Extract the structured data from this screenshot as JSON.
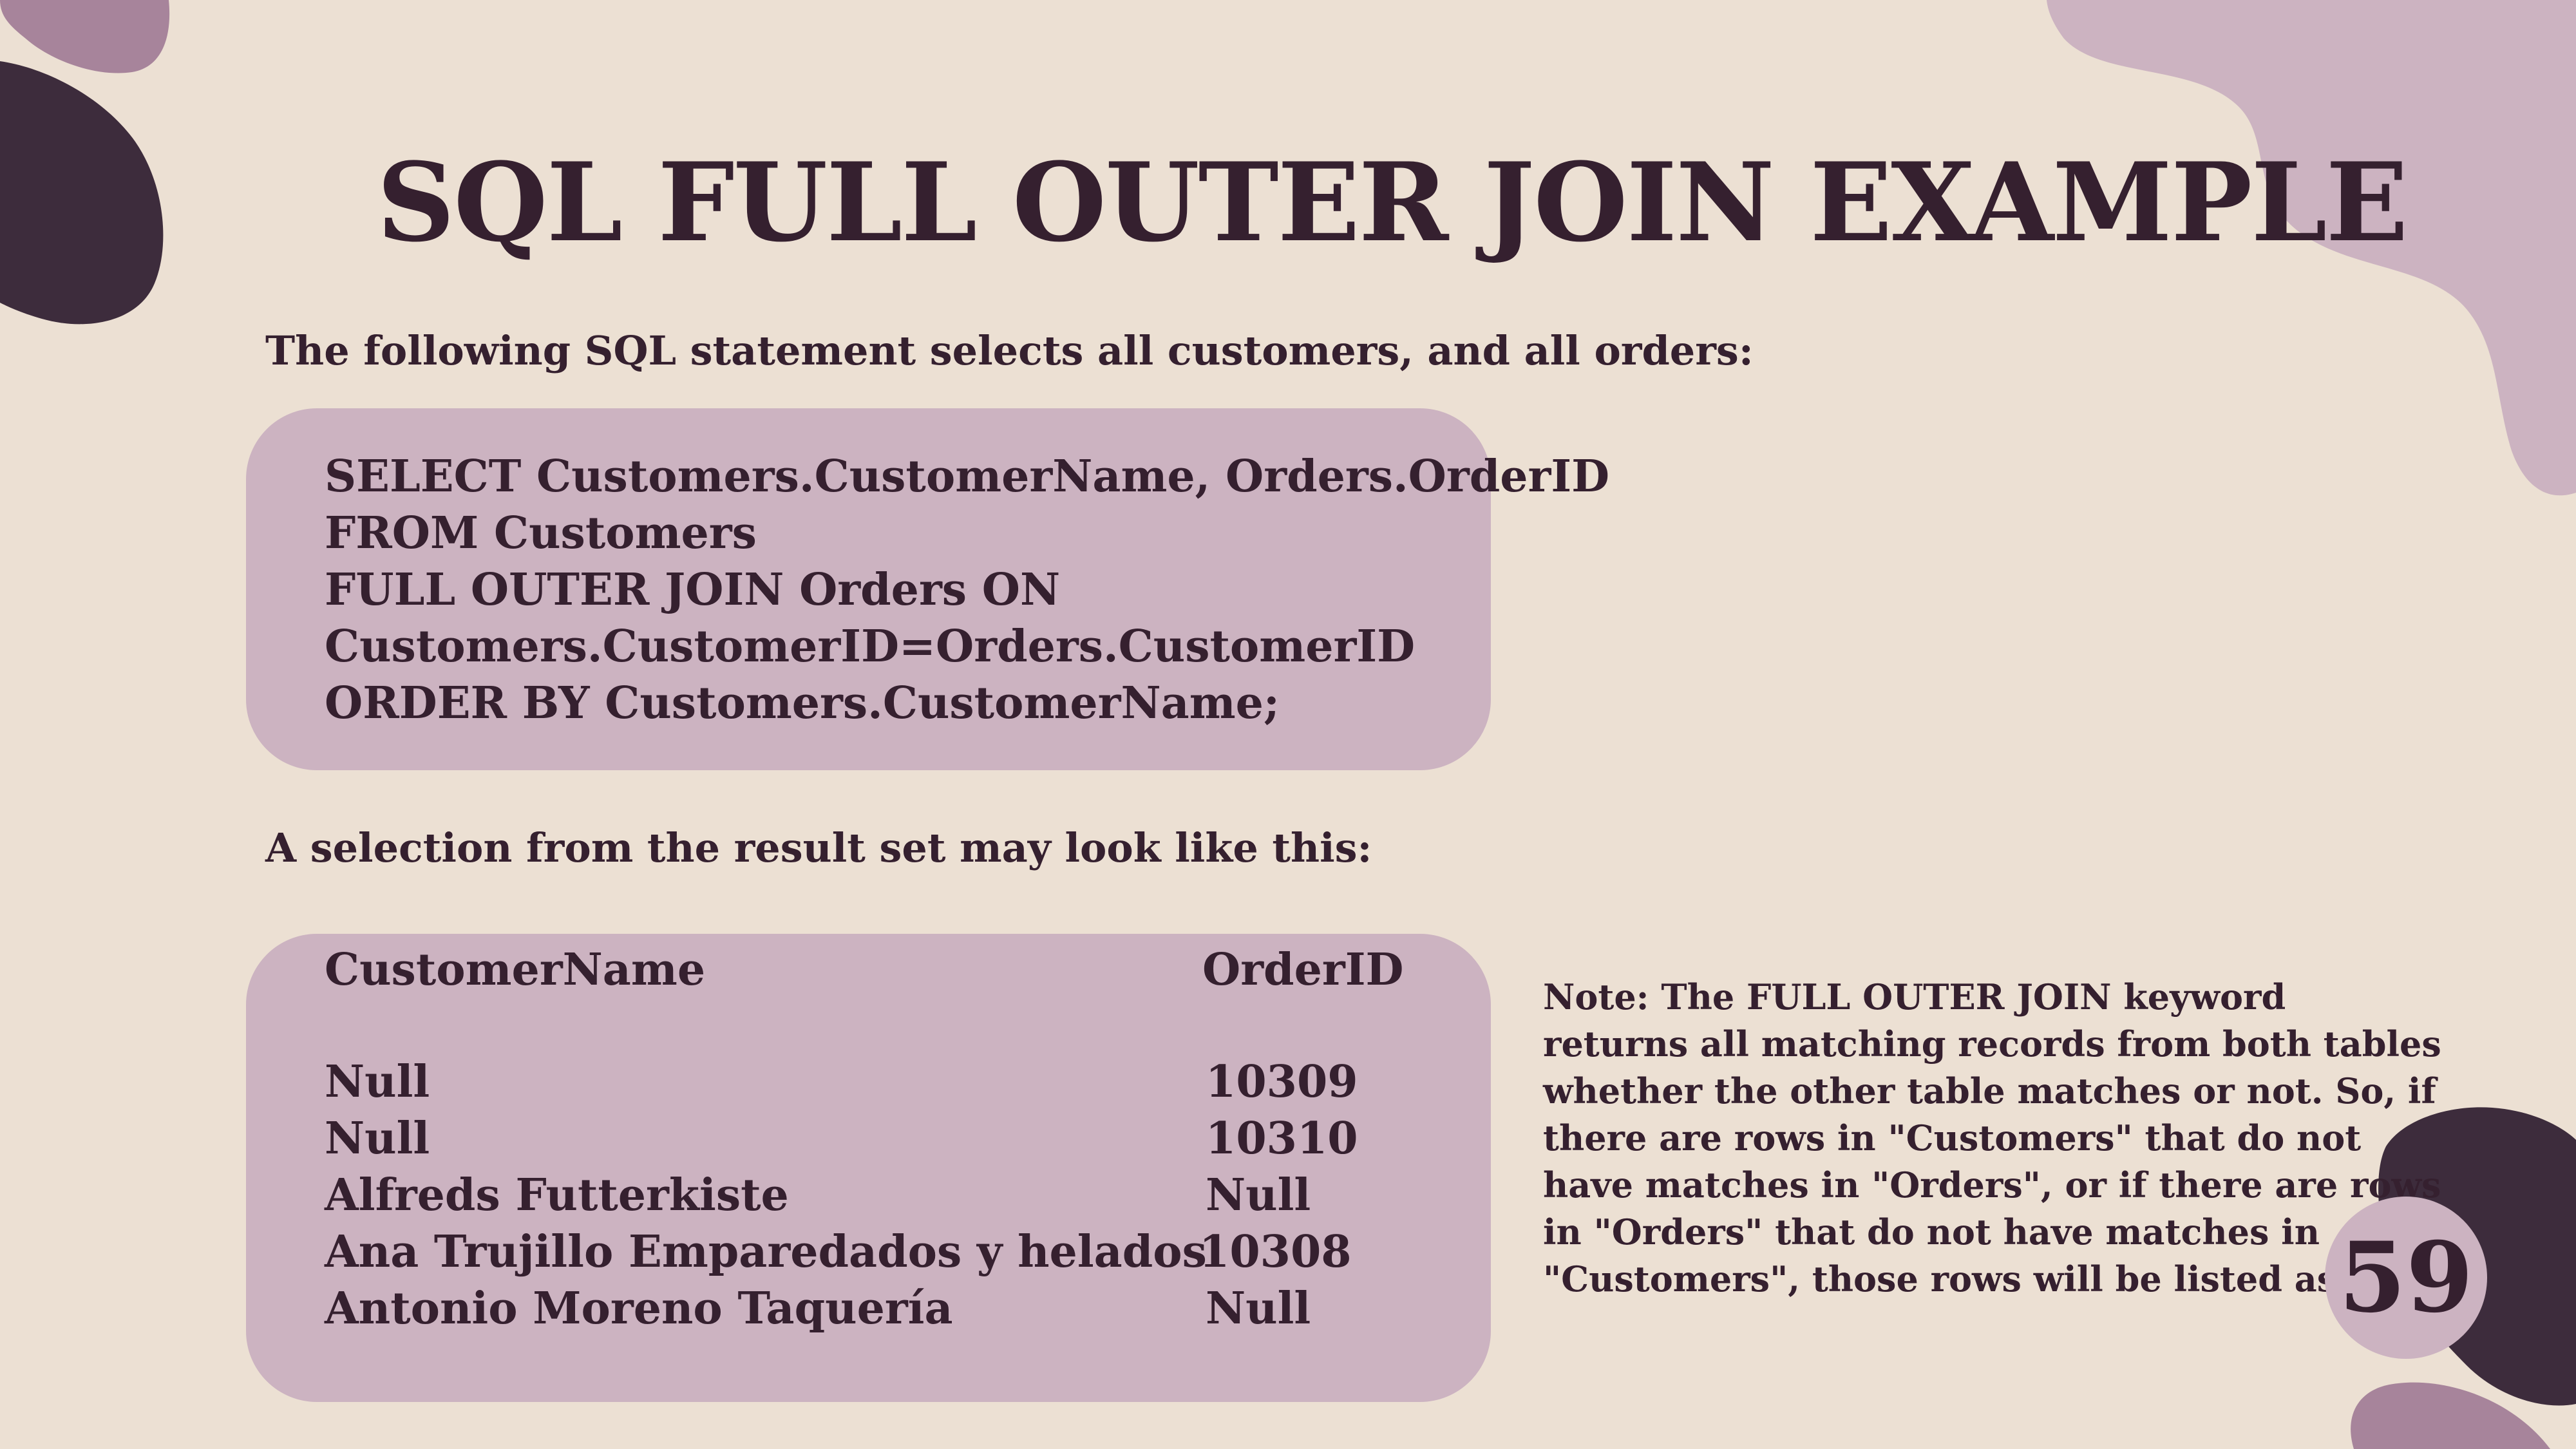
{
  "slide": {
    "title": "SQL FULL OUTER JOIN EXAMPLE",
    "intro_text": "The following SQL statement selects all customers, and all orders:",
    "code_lines": [
      "SELECT Customers.CustomerName, Orders.OrderID",
      "FROM Customers",
      "FULL OUTER JOIN Orders ON",
      "Customers.CustomerID=Orders.CustomerID",
      "ORDER BY Customers.CustomerName;"
    ],
    "result_intro": "A selection from the result set may look like this:",
    "result_table": {
      "headers": [
        "CustomerName",
        "OrderID"
      ],
      "rows": [
        [
          "Null",
          "10309"
        ],
        [
          "Null",
          "10310"
        ],
        [
          "Alfreds Futterkiste",
          "Null"
        ],
        [
          "Ana Trujillo Emparedados y helados",
          "10308"
        ],
        [
          "Antonio Moreno Taquería",
          "Null"
        ]
      ]
    },
    "note_lines": [
      "Note: The FULL OUTER JOIN keyword",
      "returns all matching records from both tables",
      "whether the other table matches or not. So, if",
      "there are rows in \"Customers\" that do not",
      "have matches in \"Orders\", or if there are rows",
      "in \"Orders\" that do not have matches in",
      "\"Customers\", those rows will be listed as well."
    ],
    "page_number": "59"
  },
  "colors": {
    "background": "#ece0d3",
    "box_fill": "#ccb3c1",
    "dark_text": "#35202f",
    "dark_blob": "#3d2c3c",
    "mauve_blob": "#a7849b",
    "light_blob": "#ccb3c1"
  }
}
